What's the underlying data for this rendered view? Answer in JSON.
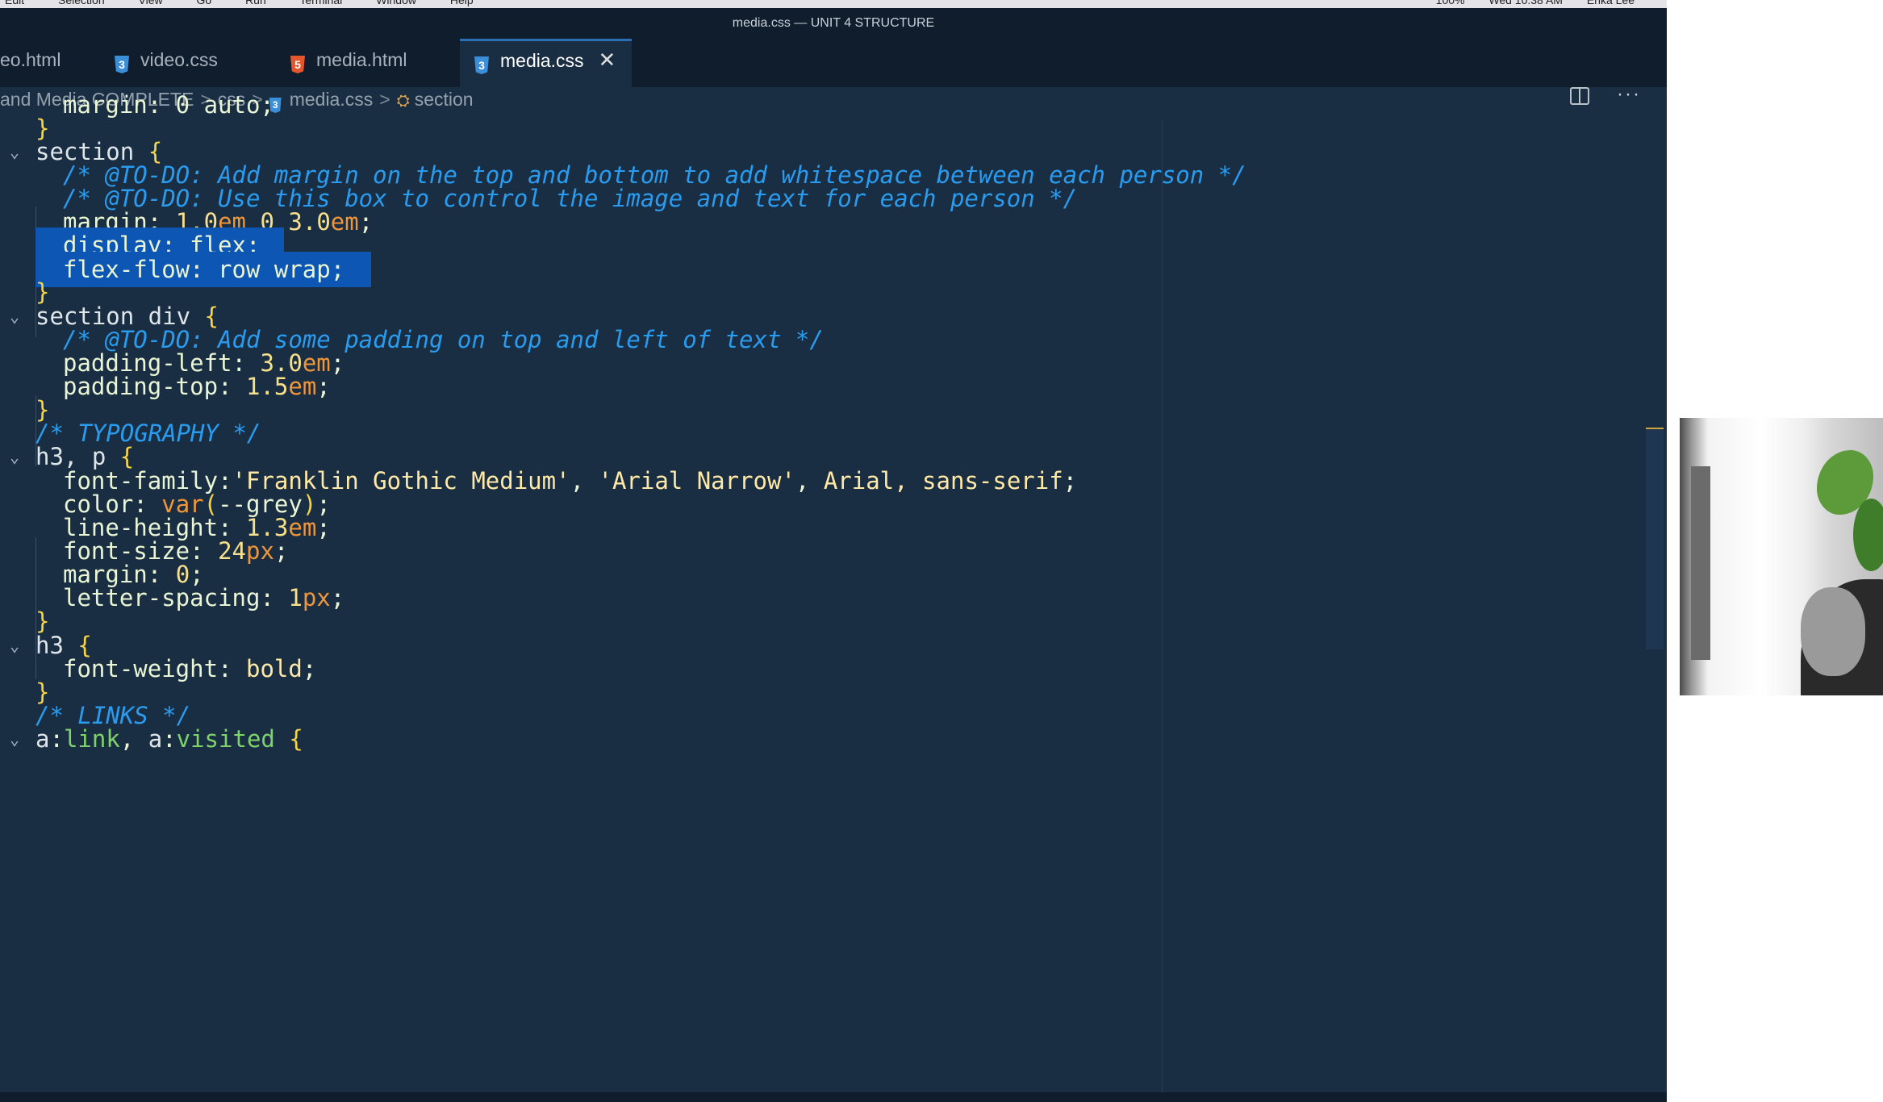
{
  "menubar": {
    "items": [
      "Edit",
      "Selection",
      "View",
      "Go",
      "Run",
      "Terminal",
      "Window",
      "Help"
    ],
    "battery": "100%",
    "clock": "Wed 10:38 AM",
    "user": "Erika Lee"
  },
  "window": {
    "title": "media.css — UNIT 4 STRUCTURE"
  },
  "tabs": [
    {
      "label": "eo.html",
      "icon": "html-file-icon",
      "active": false
    },
    {
      "label": "video.css",
      "icon": "css-file-icon",
      "active": false
    },
    {
      "label": "media.html",
      "icon": "html-file-icon",
      "active": false
    },
    {
      "label": "media.css",
      "icon": "css-file-icon",
      "active": true
    }
  ],
  "breadcrumb": {
    "folder": "and Media COMPLETE",
    "subfolder": "css",
    "file": "media.css",
    "symbol": "section"
  },
  "code": {
    "l0": "margin: 0 auto;",
    "l1": "}",
    "l2_sel": "section",
    "l3": "/* @TO-DO: Add margin on the top and bottom to add whitespace between each person */",
    "l4": "/* @TO-DO: Use this box to control the image and text for each person */",
    "l5_prop": "margin",
    "l5_a": "1.0",
    "l5_au": "em",
    "l5_b": "0",
    "l5_c": "3.0",
    "l5_cu": "em",
    "l6": "display: flex;",
    "l7": "flex-flow: row wrap;",
    "l8": "}",
    "l9_sel": "section div",
    "l10": "/* @TO-DO: Add some padding on top and left of text */",
    "l11_prop": "padding-left",
    "l11_v": "3.0",
    "l11_u": "em",
    "l12_prop": "padding-top",
    "l12_v": "1.5",
    "l12_u": "em",
    "l13": "}",
    "l14": "/* TYPOGRAPHY */",
    "l15_sel": "h3, p",
    "l16_prop": "font-family",
    "l16_s1": "'Franklin Gothic Medium'",
    "l16_s2": "'Arial Narrow'",
    "l16_rest": "Arial, sans-serif",
    "l17_prop": "color",
    "l17_fn": "var",
    "l17_arg": "--grey",
    "l18_prop": "line-height",
    "l18_v": "1.3",
    "l18_u": "em",
    "l19_prop": "font-size",
    "l19_v": "24",
    "l19_u": "px",
    "l20_prop": "margin",
    "l20_v": "0",
    "l21_prop": "letter-spacing",
    "l21_v": "1",
    "l21_u": "px",
    "l22": "}",
    "l23_sel": "h3",
    "l24_prop": "font-weight",
    "l24_v": "bold",
    "l25": "}",
    "l26": "/* LINKS */",
    "l27_a": "a",
    "l27_b": "link",
    "l27_c": "a",
    "l27_d": "visited"
  }
}
